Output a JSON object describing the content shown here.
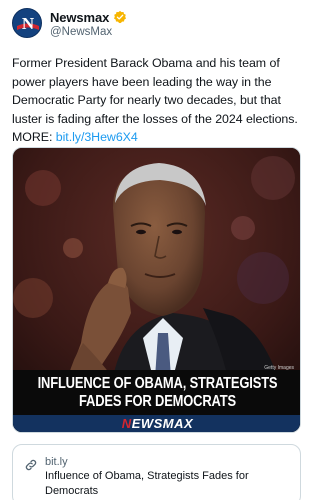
{
  "author": {
    "display_name": "Newsmax",
    "handle": "@NewsMax",
    "avatar_icon": "newsmax-n-logo",
    "avatar_letter": "N",
    "verified_icon": "verified-badge-icon",
    "verified_color": "#f7b500"
  },
  "tweet": {
    "text": "Former President Barack Obama and his team of power players have been leading the way in the Democratic Party for nearly two decades, but that luster is fading after the losses of the 2024 elections. MORE: ",
    "link_text": "bit.ly/3Hew6X4",
    "link_color": "#1d9bf0"
  },
  "media": {
    "photo_credit": "Getty Images",
    "headline_line1": "INFLUENCE OF OBAMA, STRATEGISTS",
    "headline_line2": "FADES FOR DEMOCRATS",
    "brand_prefix": "N",
    "brand_rest": "EWSMAX",
    "brand_bar_color": "#13325f"
  },
  "link_card": {
    "icon": "link-icon",
    "domain": "bit.ly",
    "title": "Influence of Obama, Strategists Fades for Democrats"
  }
}
